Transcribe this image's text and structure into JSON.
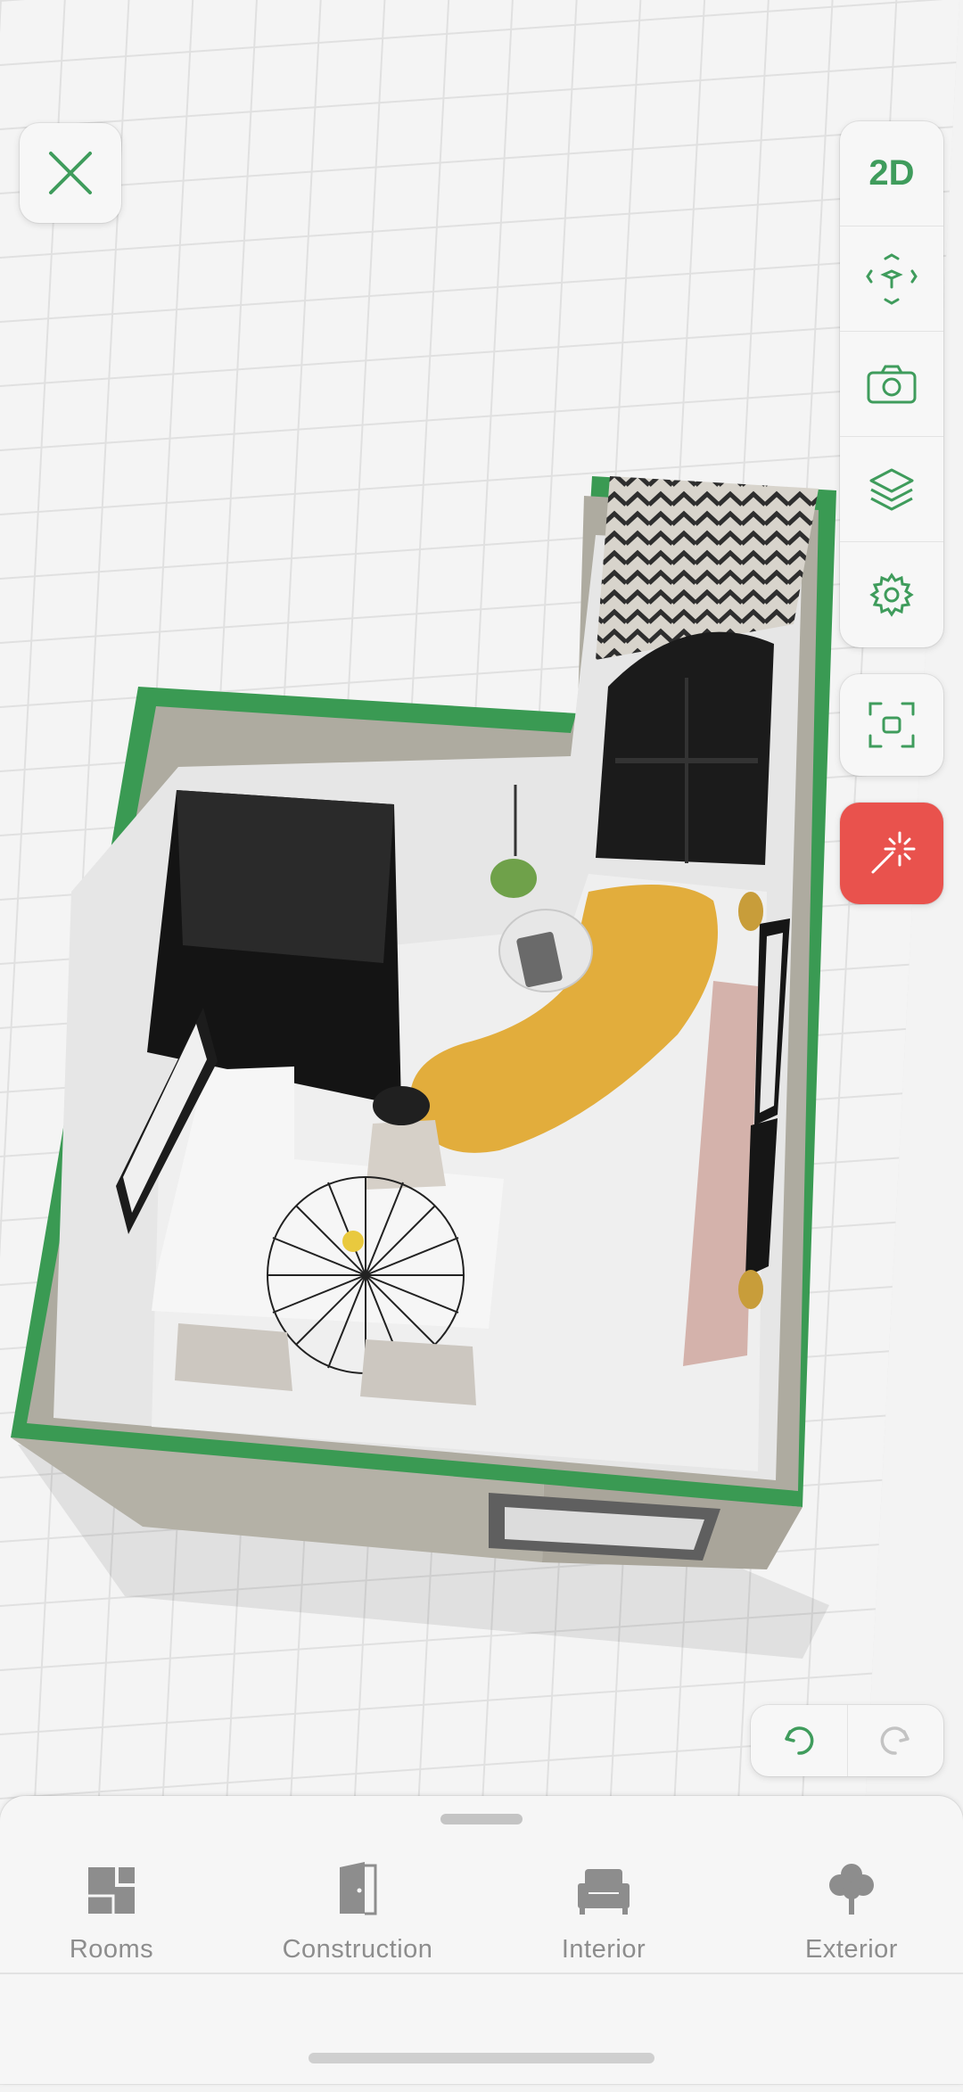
{
  "toolbar": {
    "view_toggle_label": "2D",
    "icons": [
      "fit-view-icon",
      "camera-icon",
      "layers-icon",
      "gear-icon"
    ]
  },
  "floating": {
    "close_icon": "close-icon",
    "ar_icon": "ar-scan-icon",
    "magic_icon": "magic-wand-icon",
    "undo_icon": "undo-icon",
    "redo_icon": "redo-icon"
  },
  "bottom_panel": {
    "tabs": [
      {
        "label": "Rooms",
        "icon": "rooms-icon"
      },
      {
        "label": "Construction",
        "icon": "door-icon"
      },
      {
        "label": "Interior",
        "icon": "armchair-icon"
      },
      {
        "label": "Exterior",
        "icon": "tree-icon"
      }
    ]
  },
  "colors": {
    "accent": "#3f9c5c",
    "wall_highlight": "#3a9a53",
    "magic": "#e9524d",
    "rug": "#e2ad3c",
    "floor": "#e6e6e6"
  }
}
